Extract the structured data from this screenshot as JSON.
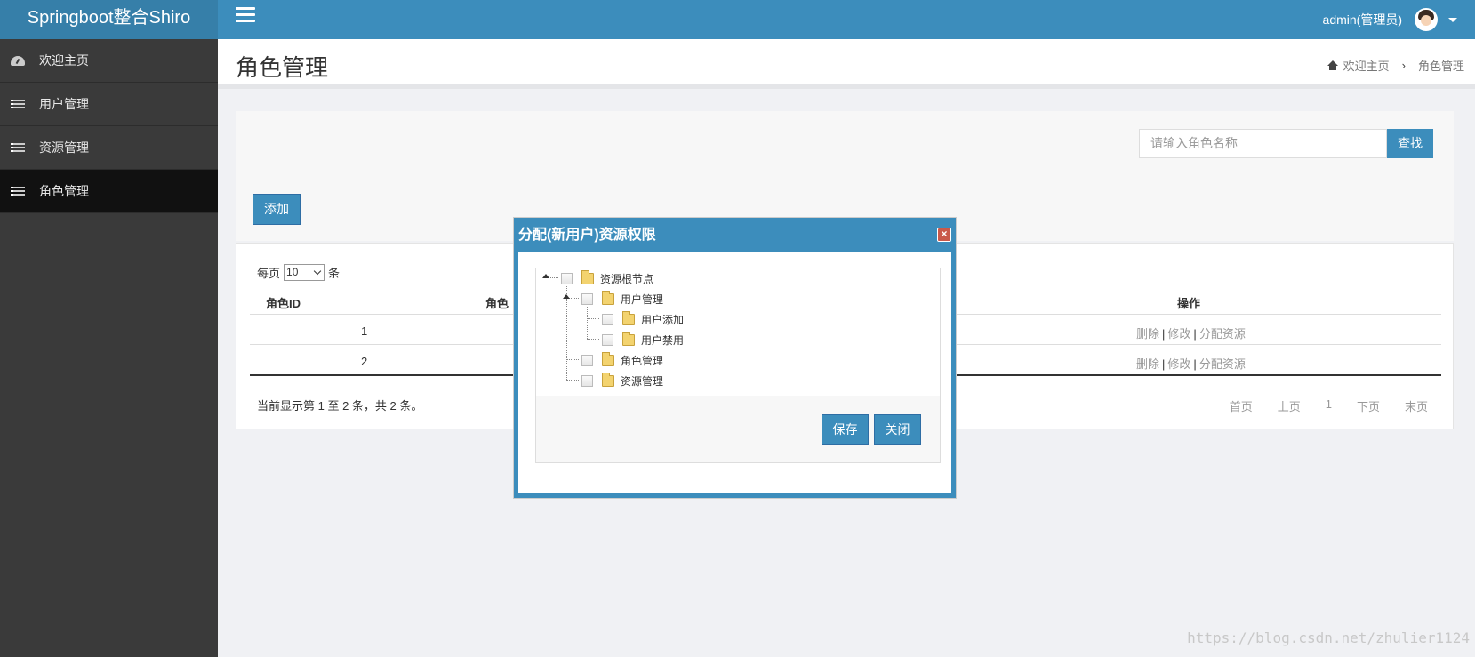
{
  "app": {
    "brand": "Springboot整合Shiro"
  },
  "header": {
    "user": "admin(管理员)"
  },
  "sidebar": {
    "items": [
      {
        "label": "欢迎主页",
        "icon": "dashboard-icon"
      },
      {
        "label": "用户管理",
        "icon": "list-icon"
      },
      {
        "label": "资源管理",
        "icon": "list-icon"
      },
      {
        "label": "角色管理",
        "icon": "list-icon",
        "active": true
      }
    ]
  },
  "page": {
    "title": "角色管理",
    "breadcrumb": {
      "home": "欢迎主页",
      "current": "角色管理"
    }
  },
  "search": {
    "placeholder": "请输入角色名称",
    "button": "查找"
  },
  "toolbar": {
    "add": "添加"
  },
  "table": {
    "page_size_prefix": "每页",
    "page_size": "10",
    "page_size_suffix": "条",
    "headers": {
      "id": "角色ID",
      "name": "角色",
      "ops": "操作"
    },
    "rows": [
      {
        "id": "1",
        "ops": [
          "删除",
          "修改",
          "分配资源"
        ]
      },
      {
        "id": "2",
        "ops": [
          "删除",
          "修改",
          "分配资源"
        ]
      }
    ],
    "op_separator": "|",
    "info": "当前显示第 1 至 2 条，共 2 条。",
    "pager": [
      "首页",
      "上页",
      "1",
      "下页",
      "末页"
    ]
  },
  "modal": {
    "title": "分配(新用户)资源权限",
    "close_symbol": "×",
    "tree": [
      {
        "label": "资源根节点"
      },
      {
        "label": "用户管理"
      },
      {
        "label": "用户添加"
      },
      {
        "label": "用户禁用"
      },
      {
        "label": "角色管理"
      },
      {
        "label": "资源管理"
      }
    ],
    "save": "保存",
    "close": "关闭"
  },
  "watermark": "https://blog.csdn.net/zhulier1124",
  "colors": {
    "primary": "#3c8dbc",
    "brand_bg": "#367fa9",
    "sidebar_bg": "#3a3a3a",
    "active_bg": "#111111"
  }
}
